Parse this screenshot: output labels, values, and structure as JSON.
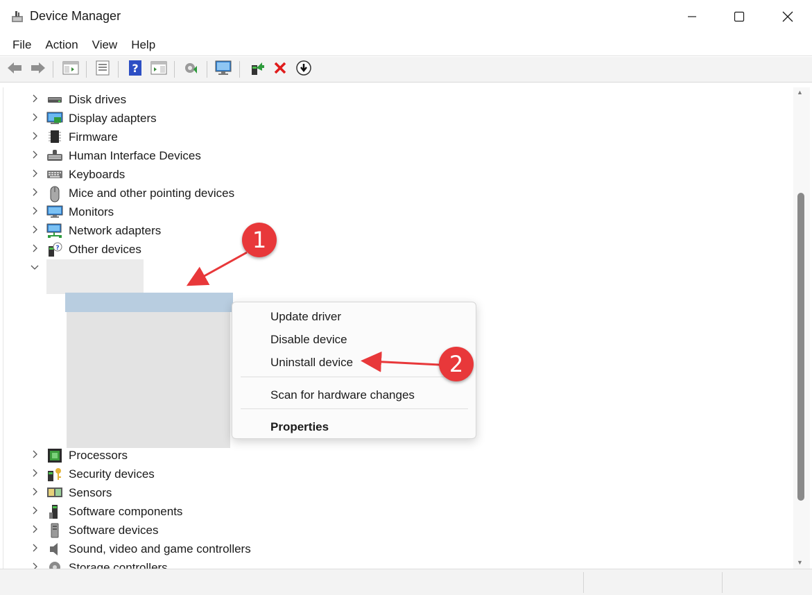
{
  "window": {
    "title": "Device Manager"
  },
  "menu": {
    "items": [
      "File",
      "Action",
      "View",
      "Help"
    ]
  },
  "tree": {
    "items_before": [
      {
        "label": "Disk drives",
        "icon": "disk-drive-icon"
      },
      {
        "label": "Display adapters",
        "icon": "display-adapter-icon"
      },
      {
        "label": "Firmware",
        "icon": "firmware-icon"
      },
      {
        "label": "Human Interface Devices",
        "icon": "hid-icon"
      },
      {
        "label": "Keyboards",
        "icon": "keyboard-icon"
      },
      {
        "label": "Mice and other pointing devices",
        "icon": "mouse-icon"
      },
      {
        "label": "Monitors",
        "icon": "monitor-icon"
      },
      {
        "label": "Network adapters",
        "icon": "network-adapter-icon"
      },
      {
        "label": "Other devices",
        "icon": "other-devices-icon"
      }
    ],
    "items_after": [
      {
        "label": "Processors",
        "icon": "processor-icon"
      },
      {
        "label": "Security devices",
        "icon": "security-device-icon"
      },
      {
        "label": "Sensors",
        "icon": "sensor-icon"
      },
      {
        "label": "Software components",
        "icon": "software-component-icon"
      },
      {
        "label": "Software devices",
        "icon": "software-device-icon"
      },
      {
        "label": "Sound, video and game controllers",
        "icon": "speaker-icon"
      },
      {
        "label": "Storage controllers",
        "icon": "storage-controller-icon"
      }
    ]
  },
  "context_menu": {
    "update_driver": "Update driver",
    "disable_device": "Disable device",
    "uninstall_device": "Uninstall device",
    "scan_hardware": "Scan for hardware changes",
    "properties": "Properties"
  },
  "annotations": {
    "badge1": "1",
    "badge2": "2",
    "color": "#e8383a"
  }
}
